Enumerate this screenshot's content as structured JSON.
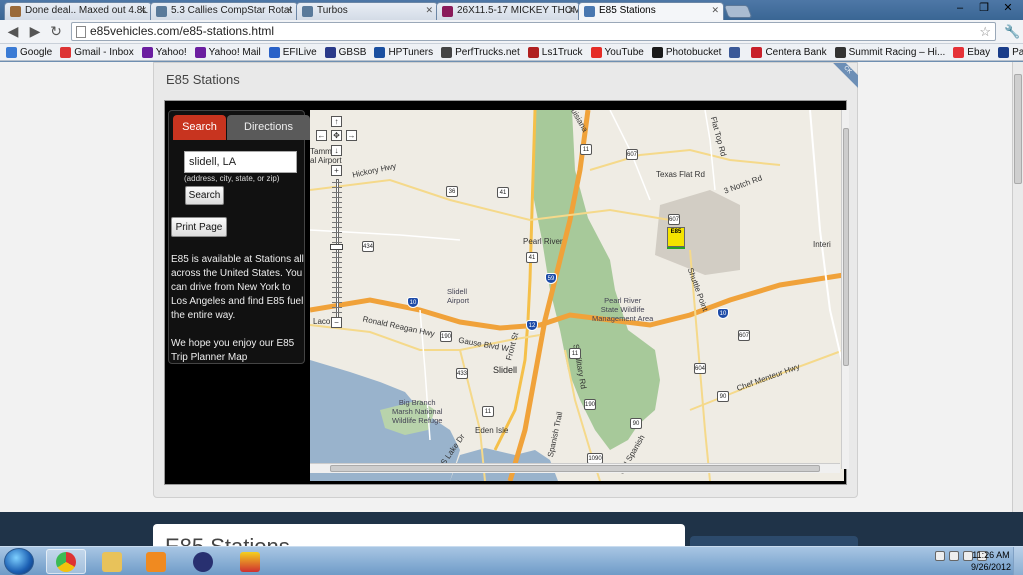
{
  "browser": {
    "tabs": [
      {
        "label": "Done deal.. Maxed out 4.8L",
        "color": "#9a6a3a"
      },
      {
        "label": "5.3 Callies CompStar Rotat",
        "color": "#5a7a9a"
      },
      {
        "label": "Turbos",
        "color": "#5a7a9a"
      },
      {
        "label": "26X11.5-17 MICKEY THOM",
        "color": "#8a1a5a"
      },
      {
        "label": "E85 Stations",
        "color": "#4a78b0"
      }
    ],
    "url": "e85vehicles.com/e85-stations.html",
    "bookmarks": [
      {
        "label": "Google",
        "color": "#3a7bd5"
      },
      {
        "label": "Gmail - Inbox",
        "color": "#d33"
      },
      {
        "label": "Yahoo!",
        "color": "#6b1ea0"
      },
      {
        "label": "Yahoo! Mail",
        "color": "#6b1ea0"
      },
      {
        "label": "EFILive",
        "color": "#2a62c8"
      },
      {
        "label": "GBSB",
        "color": "#2a3a8a"
      },
      {
        "label": "HPTuners",
        "color": "#1a4fa0"
      },
      {
        "label": "PerfTrucks.net",
        "color": "#444"
      },
      {
        "label": "Ls1Truck",
        "color": "#b02020"
      },
      {
        "label": "YouTube",
        "color": "#e52d27"
      },
      {
        "label": "Photobucket",
        "color": "#1a1a1a"
      },
      {
        "label": "",
        "color": "#3b5998"
      },
      {
        "label": "Centera Bank",
        "color": "#c8202a"
      },
      {
        "label": "Summit Racing – Hi...",
        "color": "#333"
      },
      {
        "label": "Ebay",
        "color": "#e53238"
      },
      {
        "label": "PayPal",
        "color": "#1a3d8a"
      }
    ],
    "window_buttons": [
      "–",
      "❐",
      "✕"
    ]
  },
  "page": {
    "title": "E85 Stations",
    "ribbon": "CK",
    "panel": {
      "tab_search": "Search",
      "tab_directions": "Directions",
      "address_value": "slidell, LA",
      "address_hint": "(address, city, state, or zip)",
      "search_button": "Search",
      "print_button": "Print Page",
      "promo_1": "E85 is available at Stations all across the United States. You can drive from New York to Los Angeles and find E85 fuel the entire way.",
      "promo_2": "We hope you enjoy our E85 Trip Planner Map"
    },
    "map": {
      "marker_label": "E85",
      "labels": {
        "tammany": "Tamm\nal Airport",
        "hickory": "Hickory Hwy",
        "texas_flat": "Texas Flat Rd",
        "notch": "3 Notch Rd",
        "flat_top": "Flat Top Rd",
        "pearl_river": "Pearl River",
        "inter": "Interi",
        "slidell_airport": "Slidell\nAirport",
        "pearl_river_wma": "Pearl River\nState Wildlife\nManagement Area",
        "lacom": "Laco",
        "reagan": "Ronald Reagan Hwy",
        "gause": "Gause Blvd W",
        "front": "Front St",
        "slidell": "Slidell",
        "big_branch": "Big Branch\nMarsh National\nWildlife Refuge",
        "eden": "Eden Isle",
        "military": "S Military Rd",
        "shuttle": "Shuttle Point",
        "chef": "Chef Menteur Hwy",
        "spanish": "Spanish Trail",
        "old_spanish": "Old Spanish",
        "lake": "S Lake Dr",
        "louisiana": "Louisiana"
      },
      "shields": {
        "s11_top": "11",
        "s607_top": "607",
        "s36": "36",
        "s41_a": "41",
        "s41_b": "41",
        "s434": "434",
        "s607_mid": "607",
        "s59": "59",
        "s10_a": "10",
        "s10_b": "10",
        "s12": "12",
        "s190_a": "190",
        "s190_b": "190",
        "s433": "433",
        "s11_mid": "11",
        "s11_low": "11",
        "s607_r": "607",
        "s604": "604",
        "s90_a": "90",
        "s90_b": "90",
        "s1090": "1090"
      }
    },
    "lower_title": "E85 Stations"
  },
  "taskbar": {
    "time": "11:26 AM",
    "date": "9/26/2012"
  },
  "colors": {
    "search_tab": "#c8341f",
    "water": "#99b3cc",
    "forest": "#a7c99a",
    "road_yellow": "#f5c04a",
    "road_orange": "#f0a23a"
  }
}
